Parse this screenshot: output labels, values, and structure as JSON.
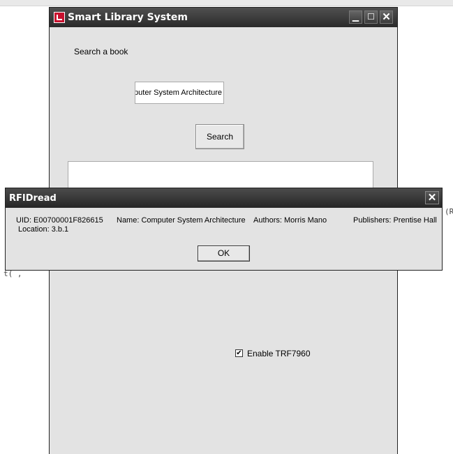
{
  "main_window": {
    "title": "Smart Library System",
    "search_label": "Search a book",
    "search_value": "Computer System Architecture",
    "search_visible_text": "nputer System Architecture",
    "search_button": "Search",
    "checkbox_label": "Enable TRF7960",
    "checkbox_checked": true,
    "check_mark": "✔"
  },
  "dialog": {
    "title": "RFIDread",
    "uid": "UID: E00700001F826615",
    "name": "Name: Computer System Architecture",
    "authors": "Authors: Morris Mano",
    "publishers": "Publishers: Prentise Hall",
    "location": "Location: 3.b.1",
    "ok_label": "OK"
  },
  "background_fragments": {
    "right_glyph": "(R",
    "left_glyph": "t(  ,"
  },
  "colors": {
    "titlebar": "#333333",
    "window_bg": "#e3e3e3"
  }
}
